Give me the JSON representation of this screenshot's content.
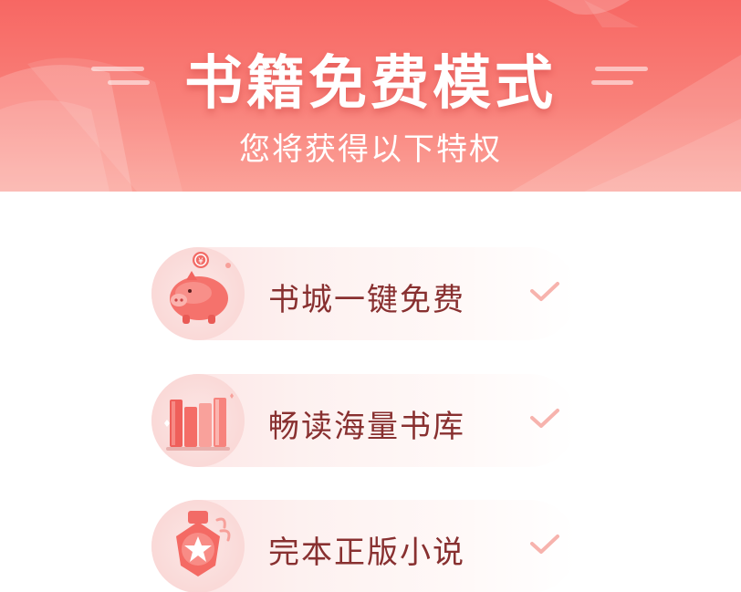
{
  "header": {
    "title": "书籍免费模式",
    "subtitle": "您将获得以下特权"
  },
  "benefits": [
    {
      "label": "书城一键免费",
      "icon": "piggy-bank-icon"
    },
    {
      "label": "畅读海量书库",
      "icon": "books-icon"
    },
    {
      "label": "完本正版小说",
      "icon": "star-medal-icon"
    }
  ],
  "colors": {
    "banner_top": "#f76763",
    "banner_bottom": "#fba39a",
    "label_text": "#883030",
    "check": "#f7b3ad"
  }
}
